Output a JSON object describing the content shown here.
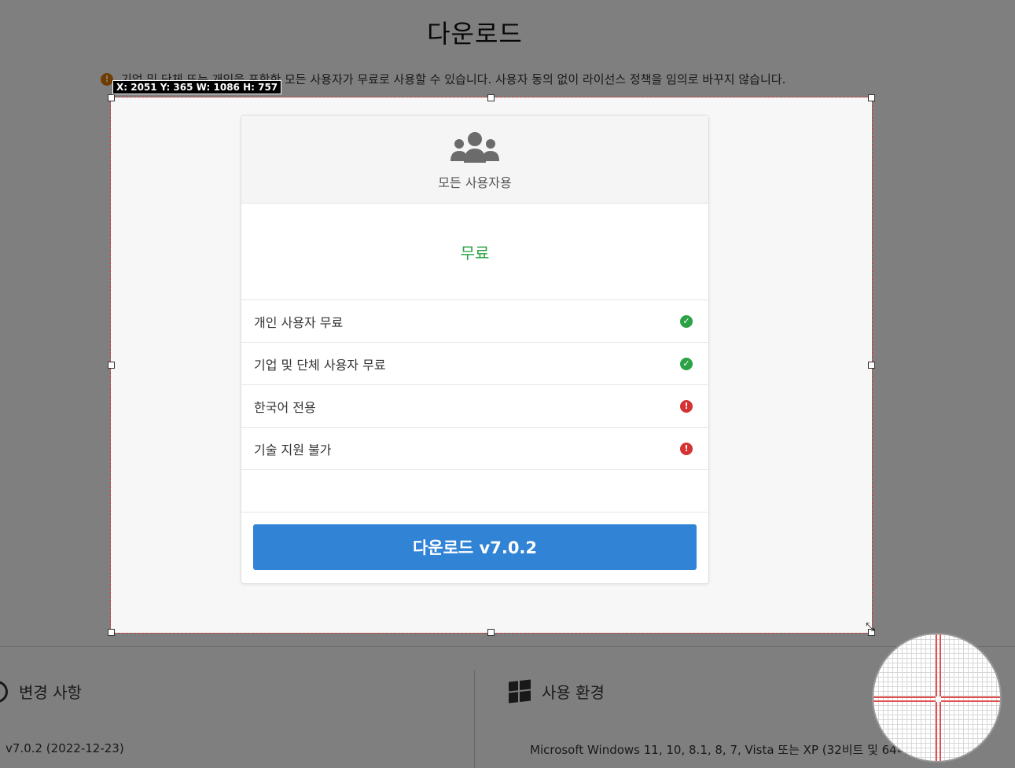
{
  "page": {
    "title": "다운로드",
    "notice": "기업 및 단체 또는 개인을 포함한 모든 사용자가 무료로 사용할 수 있습니다. 사용자 동의 없이 라이선스 정책을 임의로 바꾸지 않습니다.",
    "notice_icon": "!"
  },
  "card": {
    "header_label": "모든 사용자용",
    "header_icon": "users-icon",
    "price": "무료",
    "features": [
      {
        "label": "개인 사용자 무료",
        "status": "ok",
        "icon": "check-circle-icon"
      },
      {
        "label": "기업 및 단체 사용자 무료",
        "status": "ok",
        "icon": "check-circle-icon"
      },
      {
        "label": "한국어 전용",
        "status": "warn",
        "icon": "exclamation-circle-icon"
      },
      {
        "label": "기술 지원 불가",
        "status": "warn",
        "icon": "exclamation-circle-icon"
      }
    ],
    "download_label": "다운로드 v7.0.2",
    "status_glyphs": {
      "ok": "✓",
      "warn": "!"
    }
  },
  "bottom": {
    "history_title": "변경 사항",
    "history_value": "v7.0.2 (2022-12-23)",
    "env_title": "사용 환경",
    "env_value": "Microsoft Windows 11, 10, 8.1, 8, 7, Vista 또는 XP (32비트 및 64비트"
  },
  "capture": {
    "size_readout": "X: 2051 Y: 365 W: 1086 H: 757"
  },
  "colors": {
    "accent": "#3184d5",
    "ok": "#2ba345",
    "warn": "#d33333",
    "notice": "#e07b00",
    "selection_border": "#d43a3a"
  }
}
